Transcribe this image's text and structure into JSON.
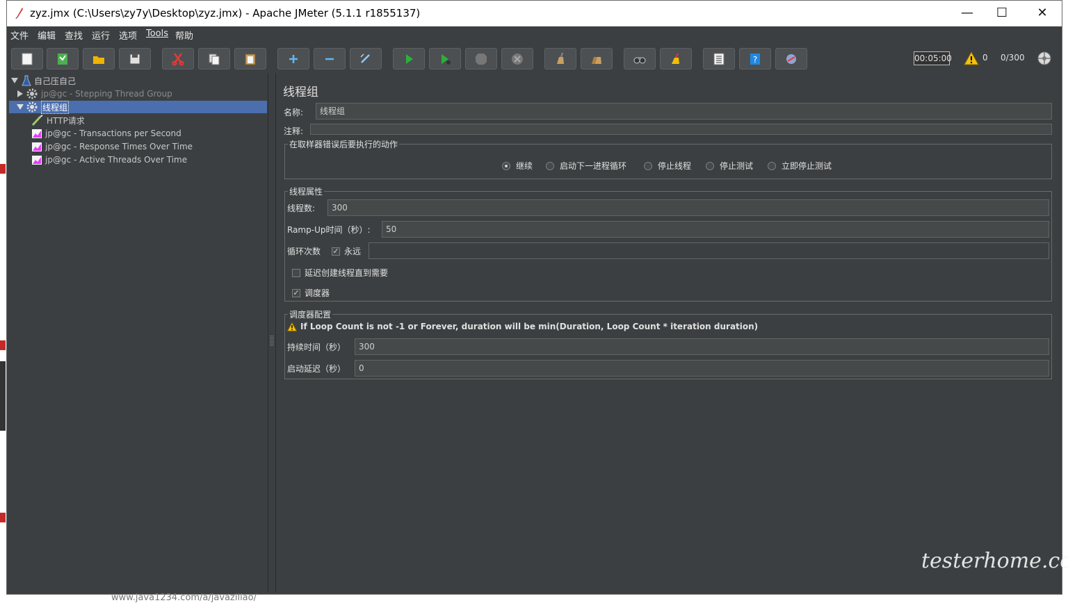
{
  "window": {
    "title": "zyz.jmx (C:\\Users\\zy7y\\Desktop\\zyz.jmx) - Apache JMeter (5.1.1 r1855137)",
    "minimize": "—",
    "maximize": "☐",
    "close": "✕"
  },
  "menu": [
    "文件",
    "编辑",
    "查找",
    "运行",
    "选项",
    "Tools",
    "帮助"
  ],
  "toolbar": {
    "buttons": [
      "new",
      "templates",
      "open",
      "save",
      "cut",
      "copy",
      "paste",
      "expand",
      "collapse",
      "toggle",
      "start",
      "start-no-pause",
      "stop",
      "shutdown",
      "clear",
      "clear-all",
      "search",
      "reset-search",
      "function-helper",
      "help",
      "remote"
    ],
    "timer": "00:05:00",
    "warnings": "0",
    "threads": "0/300"
  },
  "tree": {
    "root": "自己压自己",
    "items": [
      {
        "label": "jp@gc - Stepping Thread Group"
      },
      {
        "label": "线程组"
      },
      {
        "label": "HTTP请求"
      },
      {
        "label": "jp@gc - Transactions per Second"
      },
      {
        "label": "jp@gc - Response Times Over Time"
      },
      {
        "label": "jp@gc - Active Threads Over Time"
      }
    ]
  },
  "panel": {
    "title": "线程组",
    "name_label": "名称:",
    "name_value": "线程组",
    "comment_label": "注释:",
    "comment_value": "",
    "error_group_title": "在取样器错误后要执行的动作",
    "error_options": [
      "继续",
      "启动下一进程循环",
      "停止线程",
      "停止测试",
      "立即停止测试"
    ],
    "selected_option": "继续",
    "thread_props_title": "线程属性",
    "threads_label": "线程数:",
    "threads_value": "300",
    "rampup_label": "Ramp-Up时间（秒）:",
    "rampup_value": "50",
    "loop_label": "循环次数",
    "forever_label": "永远",
    "loop_value": "",
    "delay_label": "延迟创建线程直到需要",
    "scheduler_label": "调度器",
    "scheduler_title": "调度器配置",
    "scheduler_note": "If Loop Count is not -1 or Forever, duration will be min(Duration, Loop Count * iteration duration)",
    "duration_label": "持续时间（秒）",
    "duration_value": "300",
    "startup_label": "启动延迟（秒）",
    "startup_value": "0"
  },
  "background": {
    "watermark": "testerhome.com",
    "bottom_text": "www.java1234.com/a/javaziliao/"
  }
}
